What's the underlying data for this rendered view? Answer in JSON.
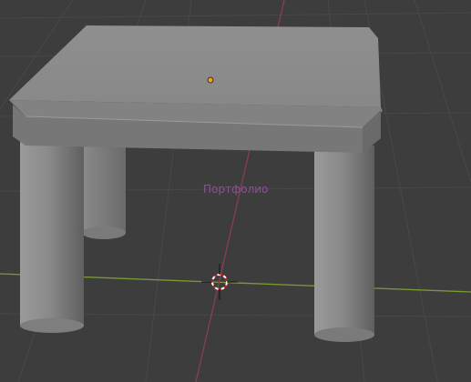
{
  "viewport": {
    "object_name": "Портфолио",
    "colors": {
      "background": "#3d3d3d",
      "grid_line": "#484848",
      "x_axis": "#7a9a36",
      "y_axis": "#8b3f4c",
      "mesh_light": "#8a8a8a",
      "mesh_shadow": "#5a5a5a",
      "origin_point": "#f0a020",
      "object_label": "#8e4f9b"
    },
    "icons": {
      "cursor": "3d-cursor-icon",
      "origin": "origin-point-icon"
    }
  }
}
